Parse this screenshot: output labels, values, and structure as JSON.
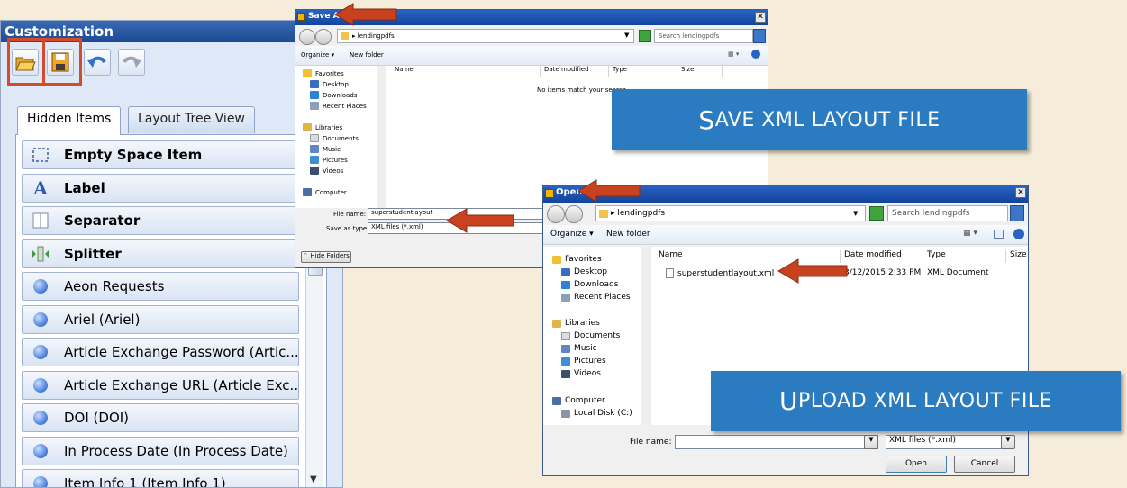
{
  "customization": {
    "title": "Customization",
    "tabs": [
      "Hidden Items",
      "Layout Tree View"
    ],
    "items": [
      {
        "label": "Empty Space Item",
        "bold": true,
        "icon": "empty-space-icon"
      },
      {
        "label": "Label",
        "bold": true,
        "icon": "label-a-icon"
      },
      {
        "label": "Separator",
        "bold": true,
        "icon": "separator-icon"
      },
      {
        "label": "Splitter",
        "bold": true,
        "icon": "splitter-icon"
      },
      {
        "label": "Aeon Requests",
        "bold": false,
        "icon": "field-ball-icon"
      },
      {
        "label": "Ariel (Ariel)",
        "bold": false,
        "icon": "field-ball-icon"
      },
      {
        "label": "Article Exchange Password (Artic...",
        "bold": false,
        "icon": "field-ball-icon"
      },
      {
        "label": "Article Exchange URL (Article Exc...",
        "bold": false,
        "icon": "field-ball-icon"
      },
      {
        "label": "DOI (DOI)",
        "bold": false,
        "icon": "field-ball-icon"
      },
      {
        "label": "In Process Date (In Process Date)",
        "bold": false,
        "icon": "field-ball-icon"
      },
      {
        "label": "Item Info 1 (Item Info 1)",
        "bold": false,
        "icon": "field-ball-icon"
      }
    ]
  },
  "save_dialog": {
    "title": "Save As",
    "folder": "lendingpdfs",
    "search_placeholder": "Search lendingpdfs",
    "organize": "Organize ▾",
    "new_folder": "New folder",
    "columns": [
      "Name",
      "Date modified",
      "Type",
      "Size"
    ],
    "empty_message": "No items match your search.",
    "nav": {
      "favorites": "Favorites",
      "fav_items": [
        "Desktop",
        "Downloads",
        "Recent Places"
      ],
      "libraries": "Libraries",
      "lib_items": [
        "Documents",
        "Music",
        "Pictures",
        "Videos"
      ],
      "computer": "Computer"
    },
    "file_name_label": "File name:",
    "file_name_value": "superstudentlayout",
    "save_type_label": "Save as type:",
    "save_type_value": "XML files (*.xml)",
    "hide_folders": "Hide Folders"
  },
  "open_dialog": {
    "title": "Open",
    "folder": "lendingpdfs",
    "search_placeholder": "Search lendingpdfs",
    "organize": "Organize ▾",
    "new_folder": "New folder",
    "columns": [
      "Name",
      "Date modified",
      "Type",
      "Size"
    ],
    "file": {
      "name": "superstudentlayout.xml",
      "date": "3/12/2015 2:33 PM",
      "type": "XML Document"
    },
    "nav": {
      "favorites": "Favorites",
      "fav_items": [
        "Desktop",
        "Downloads",
        "Recent Places"
      ],
      "libraries": "Libraries",
      "lib_items": [
        "Documents",
        "Music",
        "Pictures",
        "Videos"
      ],
      "computer": "Computer",
      "disk": "Local Disk (C:)"
    },
    "file_name_label": "File name:",
    "file_name_value": "",
    "filter_value": "XML files (*.xml)",
    "open_button": "Open",
    "cancel_button": "Cancel"
  },
  "callouts": {
    "save_first": "S",
    "save_rest": "AVE XML LAYOUT FILE",
    "upload_first": "U",
    "upload_rest": "PLOAD XML LAYOUT FILE"
  },
  "colors": {
    "callout": "#2a7bbf",
    "arrow": "#c9421f",
    "highlight": "#d34b2c"
  }
}
